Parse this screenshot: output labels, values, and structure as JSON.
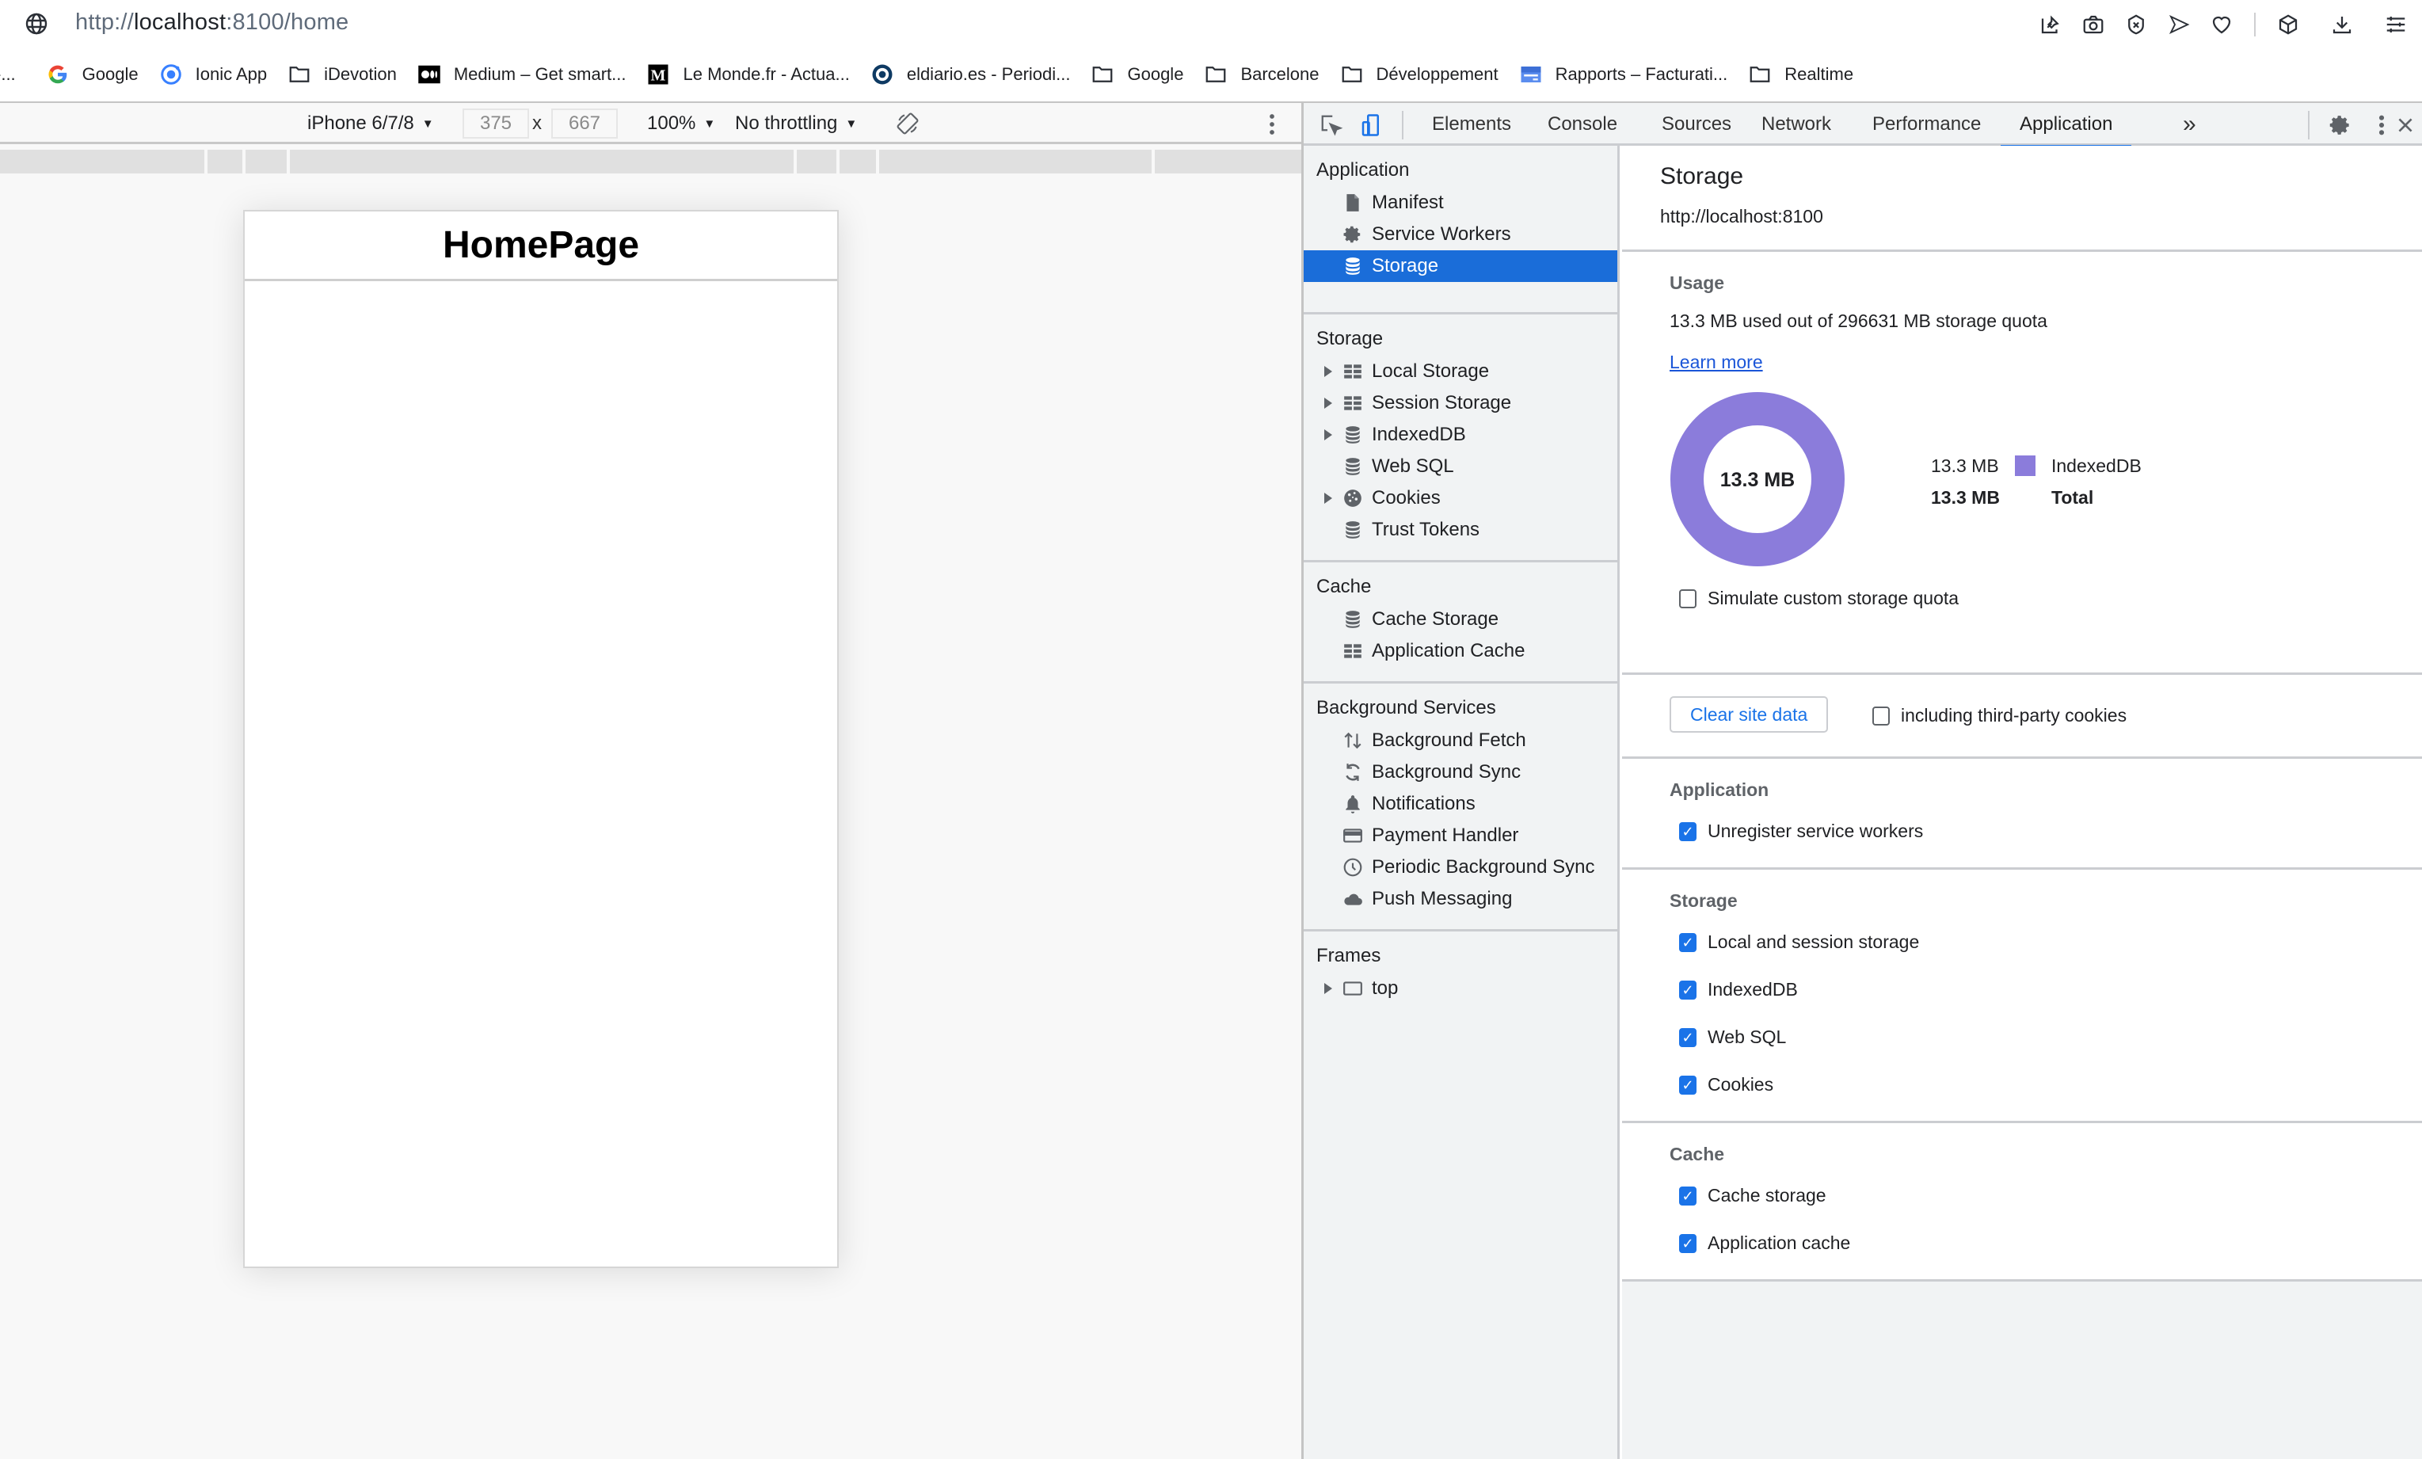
{
  "browser": {
    "url_scheme": "http://",
    "url_host": "localhost",
    "url_rest": ":8100/home",
    "toolbar_icons": [
      "pin-screenshot-icon",
      "camera-icon",
      "shield-x-icon",
      "send-icon",
      "heart-icon",
      "cube-icon",
      "download-icon",
      "sliders-icon"
    ]
  },
  "bookmarks": [
    {
      "label": "-...",
      "icon": "none"
    },
    {
      "label": "Google",
      "icon": "google-icon"
    },
    {
      "label": "Ionic App",
      "icon": "ionic-icon"
    },
    {
      "label": "iDevotion",
      "icon": "folder-icon"
    },
    {
      "label": "Medium – Get smart...",
      "icon": "medium-icon"
    },
    {
      "label": "Le Monde.fr - Actua...",
      "icon": "lemonde-icon"
    },
    {
      "label": "eldiario.es - Periodi...",
      "icon": "eldiario-icon"
    },
    {
      "label": "Google",
      "icon": "folder-icon"
    },
    {
      "label": "Barcelone",
      "icon": "folder-icon"
    },
    {
      "label": "Développement",
      "icon": "folder-icon"
    },
    {
      "label": "Rapports – Facturati...",
      "icon": "report-icon"
    },
    {
      "label": "Realtime",
      "icon": "folder-icon"
    }
  ],
  "device_toolbar": {
    "device": "iPhone 6/7/8",
    "width": "375",
    "height": "667",
    "zoom": "100%",
    "throttling": "No throttling"
  },
  "page": {
    "title": "HomePage"
  },
  "devtools": {
    "tabs": [
      "Elements",
      "Console",
      "Sources",
      "Network",
      "Performance",
      "Application"
    ],
    "active_tab": "Application",
    "sidebar": {
      "sections": [
        {
          "title": "Application",
          "items": [
            {
              "label": "Manifest",
              "icon": "file-icon",
              "expandable": false
            },
            {
              "label": "Service Workers",
              "icon": "gear-icon",
              "expandable": false
            },
            {
              "label": "Storage",
              "icon": "database-icon",
              "expandable": false,
              "selected": true
            }
          ]
        },
        {
          "title": "Storage",
          "items": [
            {
              "label": "Local Storage",
              "icon": "grid-icon",
              "expandable": true
            },
            {
              "label": "Session Storage",
              "icon": "grid-icon",
              "expandable": true
            },
            {
              "label": "IndexedDB",
              "icon": "database-icon",
              "expandable": true
            },
            {
              "label": "Web SQL",
              "icon": "database-icon",
              "expandable": false
            },
            {
              "label": "Cookies",
              "icon": "cookie-icon",
              "expandable": true
            },
            {
              "label": "Trust Tokens",
              "icon": "database-icon",
              "expandable": false
            }
          ]
        },
        {
          "title": "Cache",
          "items": [
            {
              "label": "Cache Storage",
              "icon": "database-icon",
              "expandable": false
            },
            {
              "label": "Application Cache",
              "icon": "grid-icon",
              "expandable": false
            }
          ]
        },
        {
          "title": "Background Services",
          "items": [
            {
              "label": "Background Fetch",
              "icon": "up-down-arrows-icon",
              "expandable": false
            },
            {
              "label": "Background Sync",
              "icon": "sync-icon",
              "expandable": false
            },
            {
              "label": "Notifications",
              "icon": "bell-icon",
              "expandable": false
            },
            {
              "label": "Payment Handler",
              "icon": "credit-card-icon",
              "expandable": false
            },
            {
              "label": "Periodic Background Sync",
              "icon": "clock-icon",
              "expandable": false
            },
            {
              "label": "Push Messaging",
              "icon": "cloud-icon",
              "expandable": false
            }
          ]
        },
        {
          "title": "Frames",
          "items": [
            {
              "label": "top",
              "icon": "frame-icon",
              "expandable": true
            }
          ]
        }
      ]
    },
    "storage_panel": {
      "title": "Storage",
      "origin": "http://localhost:8100",
      "usage_title": "Usage",
      "usage_text": "13.3 MB used out of 296631 MB storage quota",
      "learn_more": "Learn more",
      "simulate_quota_label": "Simulate custom storage quota",
      "simulate_quota_checked": false,
      "clear_button": "Clear site data",
      "third_party_label": "including third-party cookies",
      "third_party_checked": false,
      "groups": [
        {
          "title": "Application",
          "options": [
            {
              "label": "Unregister service workers",
              "checked": true
            }
          ]
        },
        {
          "title": "Storage",
          "options": [
            {
              "label": "Local and session storage",
              "checked": true
            },
            {
              "label": "IndexedDB",
              "checked": true
            },
            {
              "label": "Web SQL",
              "checked": true
            },
            {
              "label": "Cookies",
              "checked": true
            }
          ]
        },
        {
          "title": "Cache",
          "options": [
            {
              "label": "Cache storage",
              "checked": true
            },
            {
              "label": "Application cache",
              "checked": true
            }
          ]
        }
      ]
    }
  },
  "chart_data": {
    "type": "pie",
    "variant": "donut",
    "center_label": "13.3 MB",
    "slices": [
      {
        "name": "IndexedDB",
        "value": 13.3,
        "display": "13.3 MB",
        "color": "#8b7cdb"
      }
    ],
    "total": {
      "label": "Total",
      "value": 13.3,
      "display": "13.3 MB"
    },
    "units": "MB",
    "legend": "right"
  },
  "colors": {
    "accent": "#1a73e8",
    "selection": "#1a6dd9",
    "indexeddb": "#8b7cdb"
  }
}
